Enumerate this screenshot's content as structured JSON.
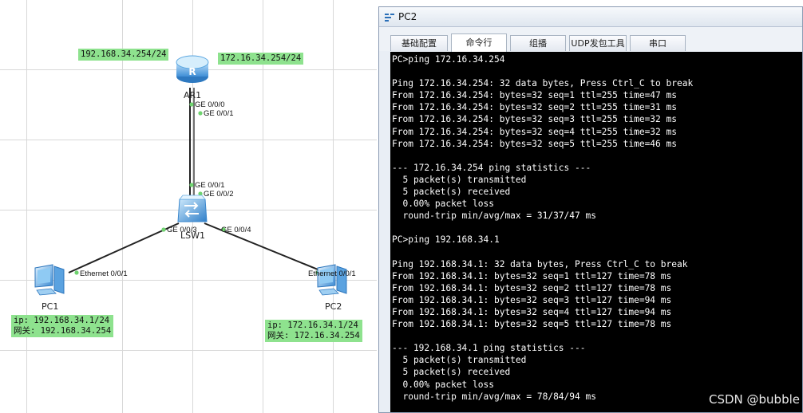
{
  "topology": {
    "router": {
      "name": "AR1",
      "ip_left": "192.168.34.254/24",
      "ip_right": "172.16.34.254/24",
      "port_up1": "GE 0/0/0",
      "port_up2": "GE 0/0/1"
    },
    "switch": {
      "name": "LSW1",
      "port_top1": "GE 0/0/1",
      "port_top2": "GE 0/0/2",
      "port_left": "GE 0/0/3",
      "port_right": "GE 0/0/4"
    },
    "pc1": {
      "name": "PC1",
      "port": "Ethernet 0/0/1",
      "ip": "ip: 192.168.34.1/24",
      "gateway": "网关: 192.168.34.254"
    },
    "pc2": {
      "name": "PC2",
      "port": "Ethernet 0/0/1",
      "ip": "ip: 172.16.34.1/24",
      "gateway": "网关: 172.16.34.254"
    },
    "colors": {
      "ip_tag": "#8ee28e",
      "link": "#222222",
      "port_dot": "#6fd36f"
    }
  },
  "window": {
    "title": "PC2",
    "tabs": [
      {
        "label": "基础配置",
        "active": false
      },
      {
        "label": "命令行",
        "active": true
      },
      {
        "label": "组播",
        "active": false
      },
      {
        "label": "UDP发包工具",
        "active": false
      },
      {
        "label": "串口",
        "active": false
      }
    ],
    "console_lines": [
      "PC>ping 172.16.34.254",
      "",
      "Ping 172.16.34.254: 32 data bytes, Press Ctrl_C to break",
      "From 172.16.34.254: bytes=32 seq=1 ttl=255 time=47 ms",
      "From 172.16.34.254: bytes=32 seq=2 ttl=255 time=31 ms",
      "From 172.16.34.254: bytes=32 seq=3 ttl=255 time=32 ms",
      "From 172.16.34.254: bytes=32 seq=4 ttl=255 time=32 ms",
      "From 172.16.34.254: bytes=32 seq=5 ttl=255 time=46 ms",
      "",
      "--- 172.16.34.254 ping statistics ---",
      "  5 packet(s) transmitted",
      "  5 packet(s) received",
      "  0.00% packet loss",
      "  round-trip min/avg/max = 31/37/47 ms",
      "",
      "PC>ping 192.168.34.1",
      "",
      "Ping 192.168.34.1: 32 data bytes, Press Ctrl_C to break",
      "From 192.168.34.1: bytes=32 seq=1 ttl=127 time=78 ms",
      "From 192.168.34.1: bytes=32 seq=2 ttl=127 time=78 ms",
      "From 192.168.34.1: bytes=32 seq=3 ttl=127 time=94 ms",
      "From 192.168.34.1: bytes=32 seq=4 ttl=127 time=94 ms",
      "From 192.168.34.1: bytes=32 seq=5 ttl=127 time=78 ms",
      "",
      "--- 192.168.34.1 ping statistics ---",
      "  5 packet(s) transmitted",
      "  5 packet(s) received",
      "  0.00% packet loss",
      "  round-trip min/avg/max = 78/84/94 ms"
    ]
  },
  "watermark": "CSDN @bubble"
}
